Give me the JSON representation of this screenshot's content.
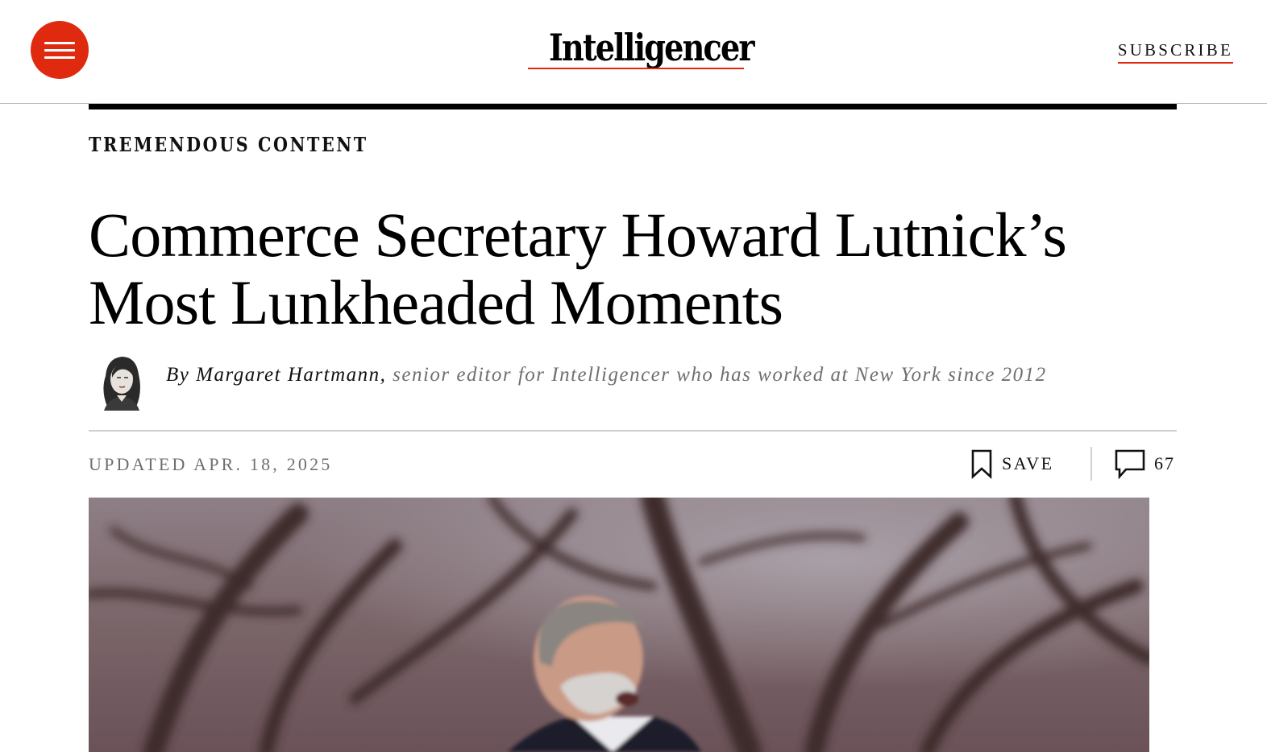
{
  "header": {
    "logo_text": "Intelligencer",
    "subscribe_label": "SUBSCRIBE",
    "menu_icon": "hamburger-menu-icon",
    "brand_color": "#e02a10"
  },
  "article": {
    "rubric": "TREMENDOUS CONTENT",
    "headline_line1": "Commerce Secretary Howard Lutnick’s",
    "headline_line2": "Most Lunkheaded Moments",
    "byline_author": "By Margaret Hartmann,",
    "byline_description": "senior editor for Intelligencer who has worked at New York since 2012",
    "updated": "UPDATED APR. 18, 2025",
    "save_label": "SAVE",
    "save_icon": "bookmark-icon",
    "comment_icon": "comment-bubble-icon",
    "comment_count": "67"
  }
}
